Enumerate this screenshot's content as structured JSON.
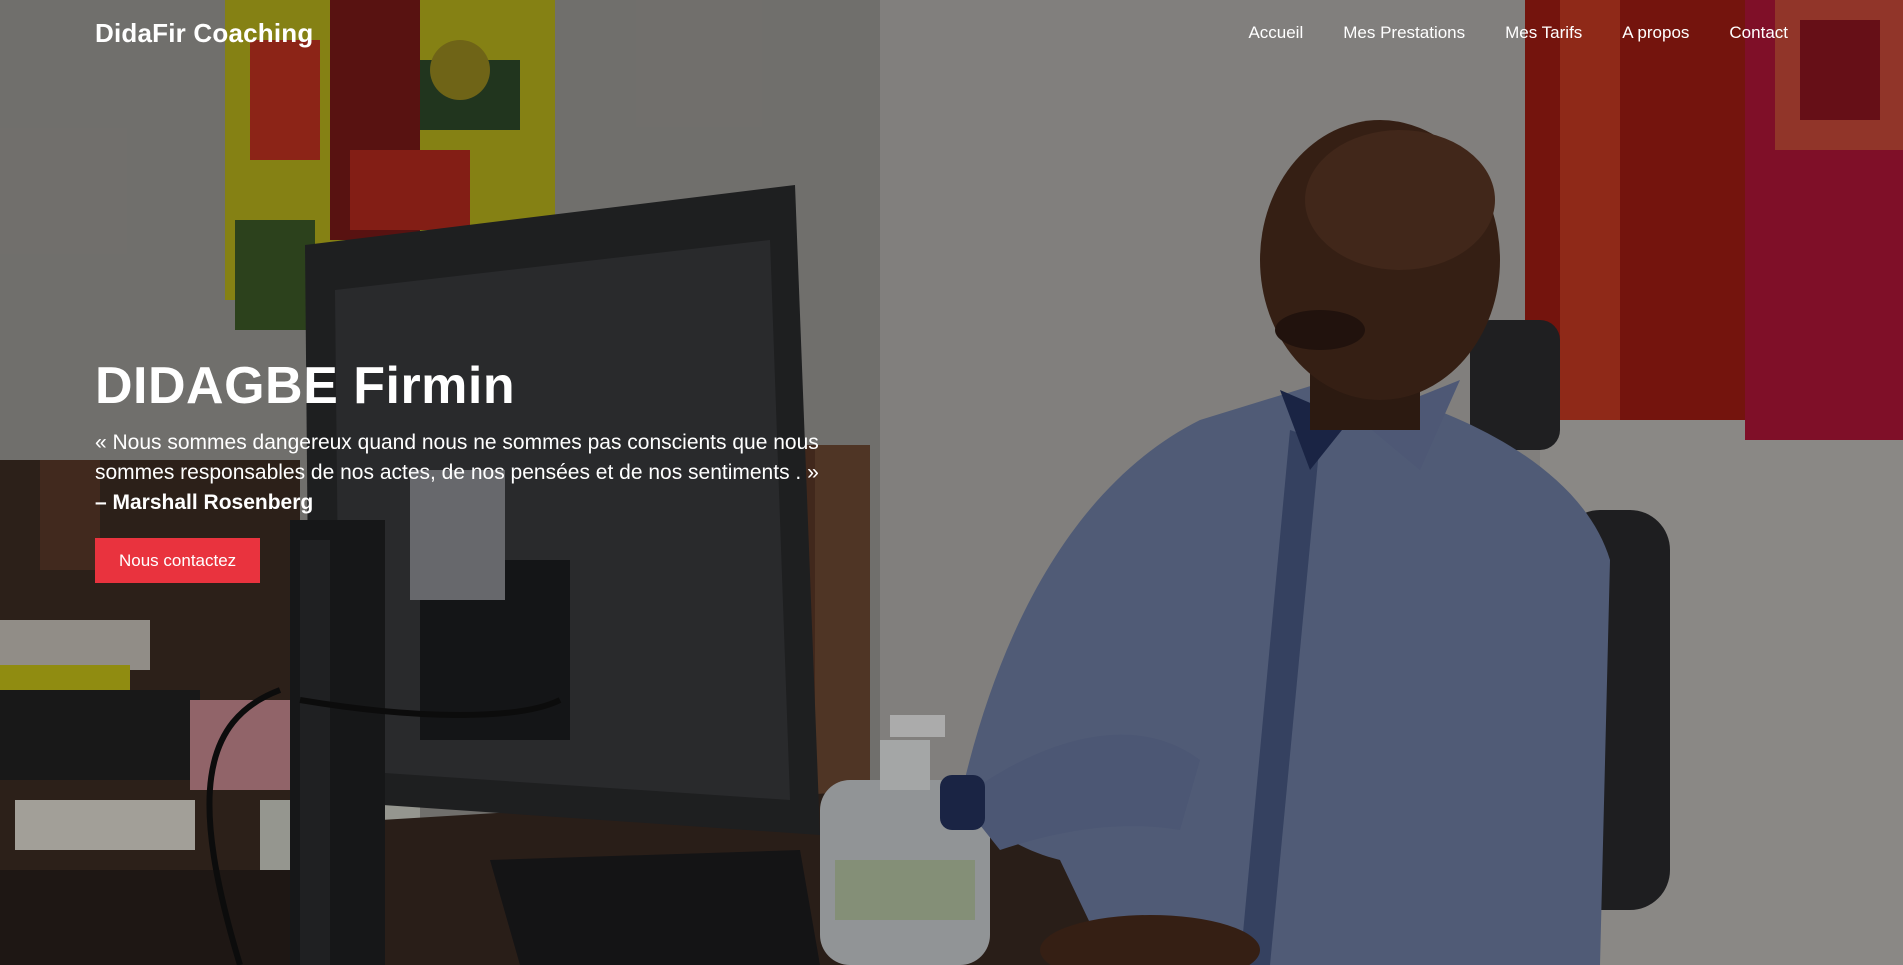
{
  "header": {
    "brand": "DidaFir Coaching",
    "nav": [
      {
        "label": "Accueil"
      },
      {
        "label": "Mes Prestations"
      },
      {
        "label": "Mes Tarifs"
      },
      {
        "label": "A propos"
      },
      {
        "label": "Contact"
      }
    ]
  },
  "hero": {
    "title": "DIDAGBE Firmin",
    "quote": "« Nous sommes dangereux quand nous ne sommes pas conscients que nous sommes responsables de nos actes, de nos pensées et de nos sentiments . »",
    "author": "– Marshall Rosenberg",
    "cta_label": "Nous contactez"
  },
  "colors": {
    "accent": "#e9333e",
    "text": "#ffffff"
  }
}
